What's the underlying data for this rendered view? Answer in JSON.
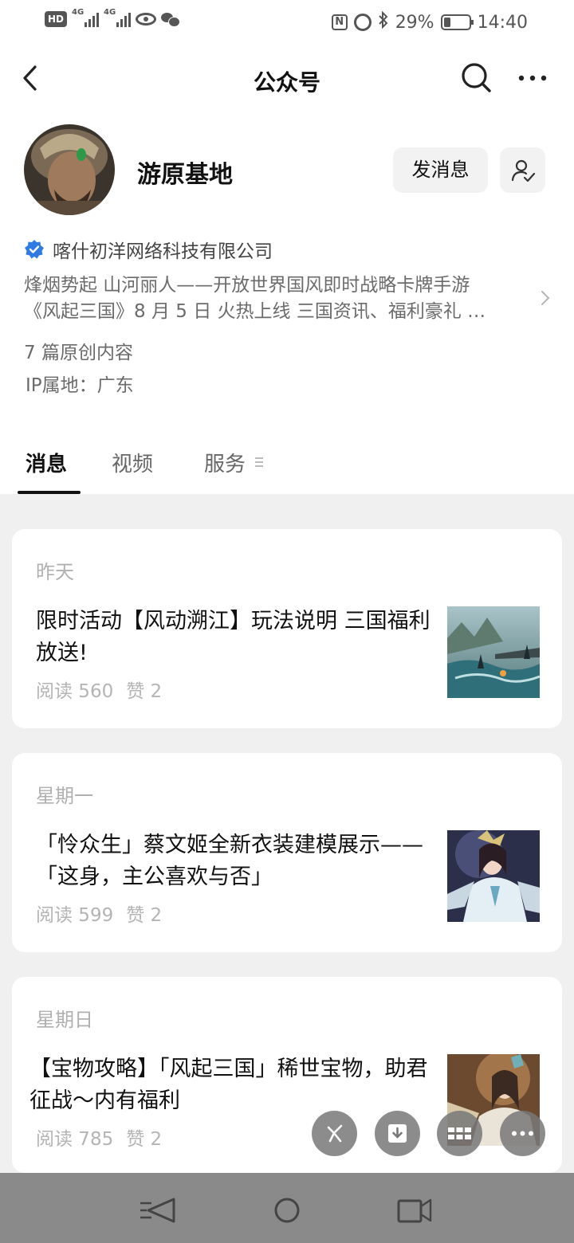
{
  "status_bar": {
    "left_badge": "HD",
    "sim1_label": "4G",
    "sim2_label": "4G",
    "nfc": "N",
    "battery": "29%",
    "battery_level": 0.29,
    "time": "14:40"
  },
  "nav": {
    "title": "公众号"
  },
  "profile": {
    "name": "游原基地",
    "message_button": "发消息",
    "company": "喀什初洋网络科技有限公司",
    "description_line1": "烽烟势起 山河丽人——开放世界国风即时战略卡牌手游",
    "description_line2": "《风起三国》8 月 5 日 火热上线 三国资讯、福利豪礼 …",
    "original_count": "7 篇原创内容",
    "ip_location": "IP属地：广东"
  },
  "tabs": [
    {
      "label": "消息",
      "active": true
    },
    {
      "label": "视频",
      "active": false
    },
    {
      "label": "服务",
      "active": false
    }
  ],
  "articles": [
    {
      "date": "昨天",
      "title": "限时活动【风动溯江】玩法说明 三国福利放送!",
      "reads": "阅读 560",
      "likes": "赞 2"
    },
    {
      "date": "星期一",
      "title": "「怜众生」蔡文姬全新衣装建模展示——「这身，主公喜欢与否」",
      "reads": "阅读 599",
      "likes": "赞 2"
    },
    {
      "date": "星期日",
      "title": "【宝物攻略】「风起三国」稀世宝物，助君征战～内有福利",
      "reads": "阅读 785",
      "likes": "赞 2"
    }
  ],
  "colors": {
    "background": "#f0f0f0",
    "verified_blue": "#2f7be5",
    "system_nav": "#8a8a8a"
  },
  "icons": {
    "back": "chevron-left-icon",
    "search": "search-icon",
    "more": "more-dots-icon",
    "follow": "user-check-icon",
    "verified": "verified-badge-icon",
    "fab": [
      "mini-program-icon",
      "download-icon",
      "grid-icon",
      "more-dots-icon"
    ],
    "system": [
      "back-triangle-icon",
      "home-circle-icon",
      "recents-square-icon"
    ]
  }
}
